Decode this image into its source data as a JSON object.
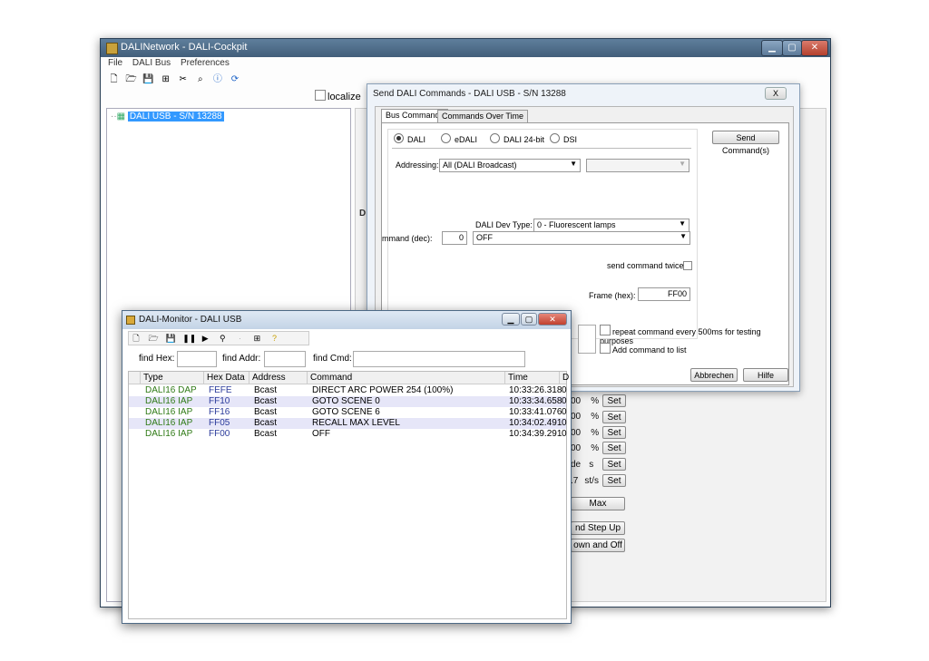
{
  "main_window": {
    "title": "DALINetwork - DALI-Cockpit",
    "menu": [
      "File",
      "DALI Bus",
      "Preferences"
    ],
    "localize_label": "localize",
    "tree_item": "DALI USB - S/N 13288",
    "partial_rows": [
      {
        "value": "00",
        "unit": "%",
        "button": "Set"
      },
      {
        "value": "00",
        "unit": "%",
        "button": "Set"
      },
      {
        "value": "00",
        "unit": "%",
        "button": "Set"
      },
      {
        "value": "00",
        "unit": "%",
        "button": "Set"
      },
      {
        "value": "de",
        "unit": "s",
        "button": "Set"
      },
      {
        "value": ".7",
        "unit": "st/s",
        "button": "Set"
      }
    ],
    "partial_buttons": [
      "Max",
      "nd Step Up",
      "own and Off"
    ]
  },
  "dialog": {
    "title": "Send DALI Commands - DALI USB - S/N 13288",
    "close_label": "X",
    "tabs": [
      "Bus Commands",
      "Commands Over Time"
    ],
    "radios": [
      "DALI",
      "eDALI",
      "DALI 24-bit",
      "DSI"
    ],
    "addressing_label": "Addressing:",
    "addressing_value": "All (DALI Broadcast)",
    "dev_type_label": "DALI Dev Type:",
    "dev_type_value": "0 - Fluorescent lamps",
    "command_label": "mmand (dec):",
    "command_dec": "0",
    "command_value": "OFF",
    "send_twice_label": "send command twice",
    "frame_label": "Frame (hex):",
    "frame_value": "FF00",
    "send_button": "Send Command(s)",
    "repeat_label": "repeat command every 500ms for testing purposes",
    "add_to_list_label": "Add command to list",
    "cancel_button": "Abbrechen",
    "help_button": "Hilfe"
  },
  "monitor": {
    "title": "DALI-Monitor - DALI USB",
    "find_hex_label": "find Hex:",
    "find_addr_label": "find Addr:",
    "find_cmd_label": "find Cmd:",
    "columns": [
      "Type",
      "Hex Data",
      "Address",
      "Command",
      "Time",
      "D"
    ],
    "rows": [
      {
        "type": "DALI16 DAP",
        "hex": "FEFE",
        "address": "Bcast",
        "command": "DIRECT ARC POWER 254 (100%)",
        "time": "10:33:26.318",
        "d": "0"
      },
      {
        "type": "DALI16 IAP",
        "hex": "FF10",
        "address": "Bcast",
        "command": "GOTO SCENE 0",
        "time": "10:33:34.658",
        "d": "0"
      },
      {
        "type": "DALI16 IAP",
        "hex": "FF16",
        "address": "Bcast",
        "command": "GOTO SCENE 6",
        "time": "10:33:41.076",
        "d": "0"
      },
      {
        "type": "DALI16 IAP",
        "hex": "FF05",
        "address": "Bcast",
        "command": "RECALL MAX LEVEL",
        "time": "10:34:02.491",
        "d": "0"
      },
      {
        "type": "DALI16 IAP",
        "hex": "FF00",
        "address": "Bcast",
        "command": "OFF",
        "time": "10:34:39.291",
        "d": "0"
      }
    ]
  }
}
